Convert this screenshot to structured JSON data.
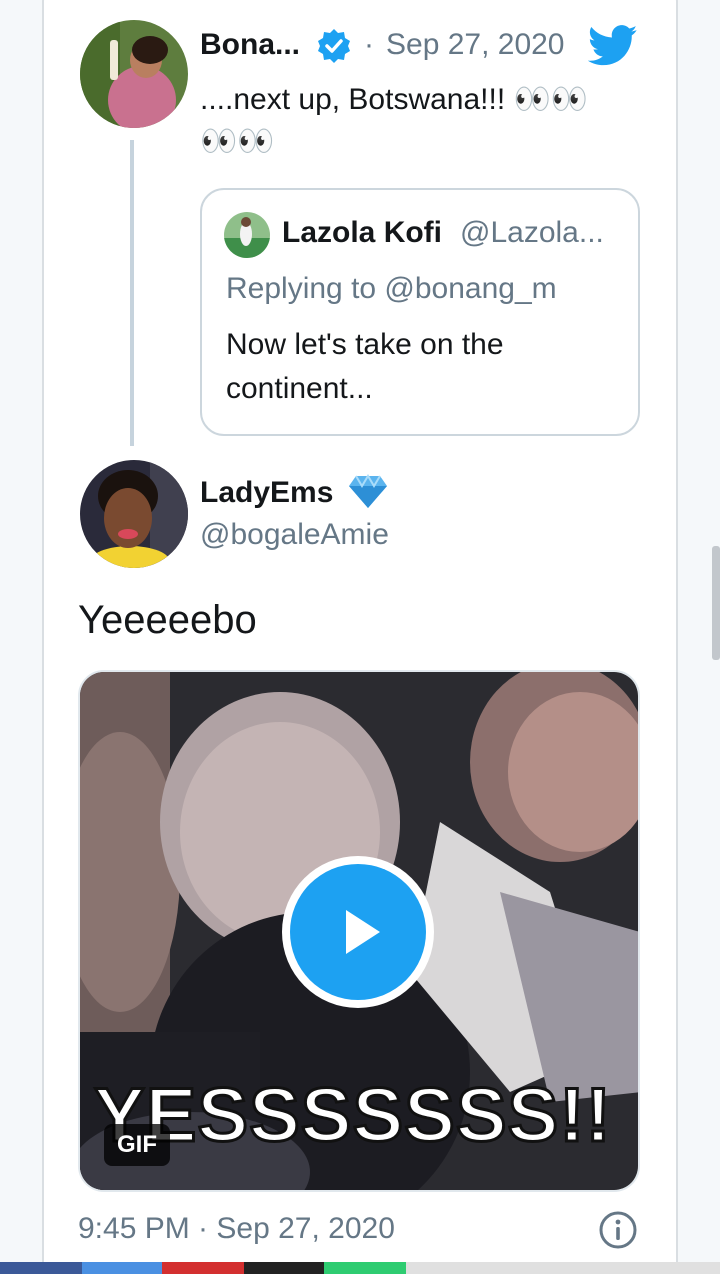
{
  "tweet1": {
    "name": "Bona...",
    "dot": "·",
    "date": "Sep 27, 2020",
    "text_line1": "....next up, Botswana!!! 👀👀",
    "text_line2": "👀👀"
  },
  "quoted": {
    "name": "Lazola Kofi",
    "handle": "@Lazola...",
    "replying": "Replying to @bonang_m",
    "text_line1": "Now let's take on the",
    "text_line2": "continent..."
  },
  "tweet2": {
    "name": "LadyEms",
    "handle": "@bogaleAmie",
    "text": "Yeeeeebo",
    "gif_caption": "YESSSSSSS!!",
    "gif_badge": "GIF",
    "timestamp": "9:45 PM · Sep 27, 2020"
  },
  "colors": {
    "accent": "#1da1f2",
    "muted": "#657786",
    "nav": [
      "#3b5998",
      "#4a90e2",
      "#d32f2f",
      "#222222",
      "#2ecc71",
      "#e0e0e0"
    ]
  }
}
